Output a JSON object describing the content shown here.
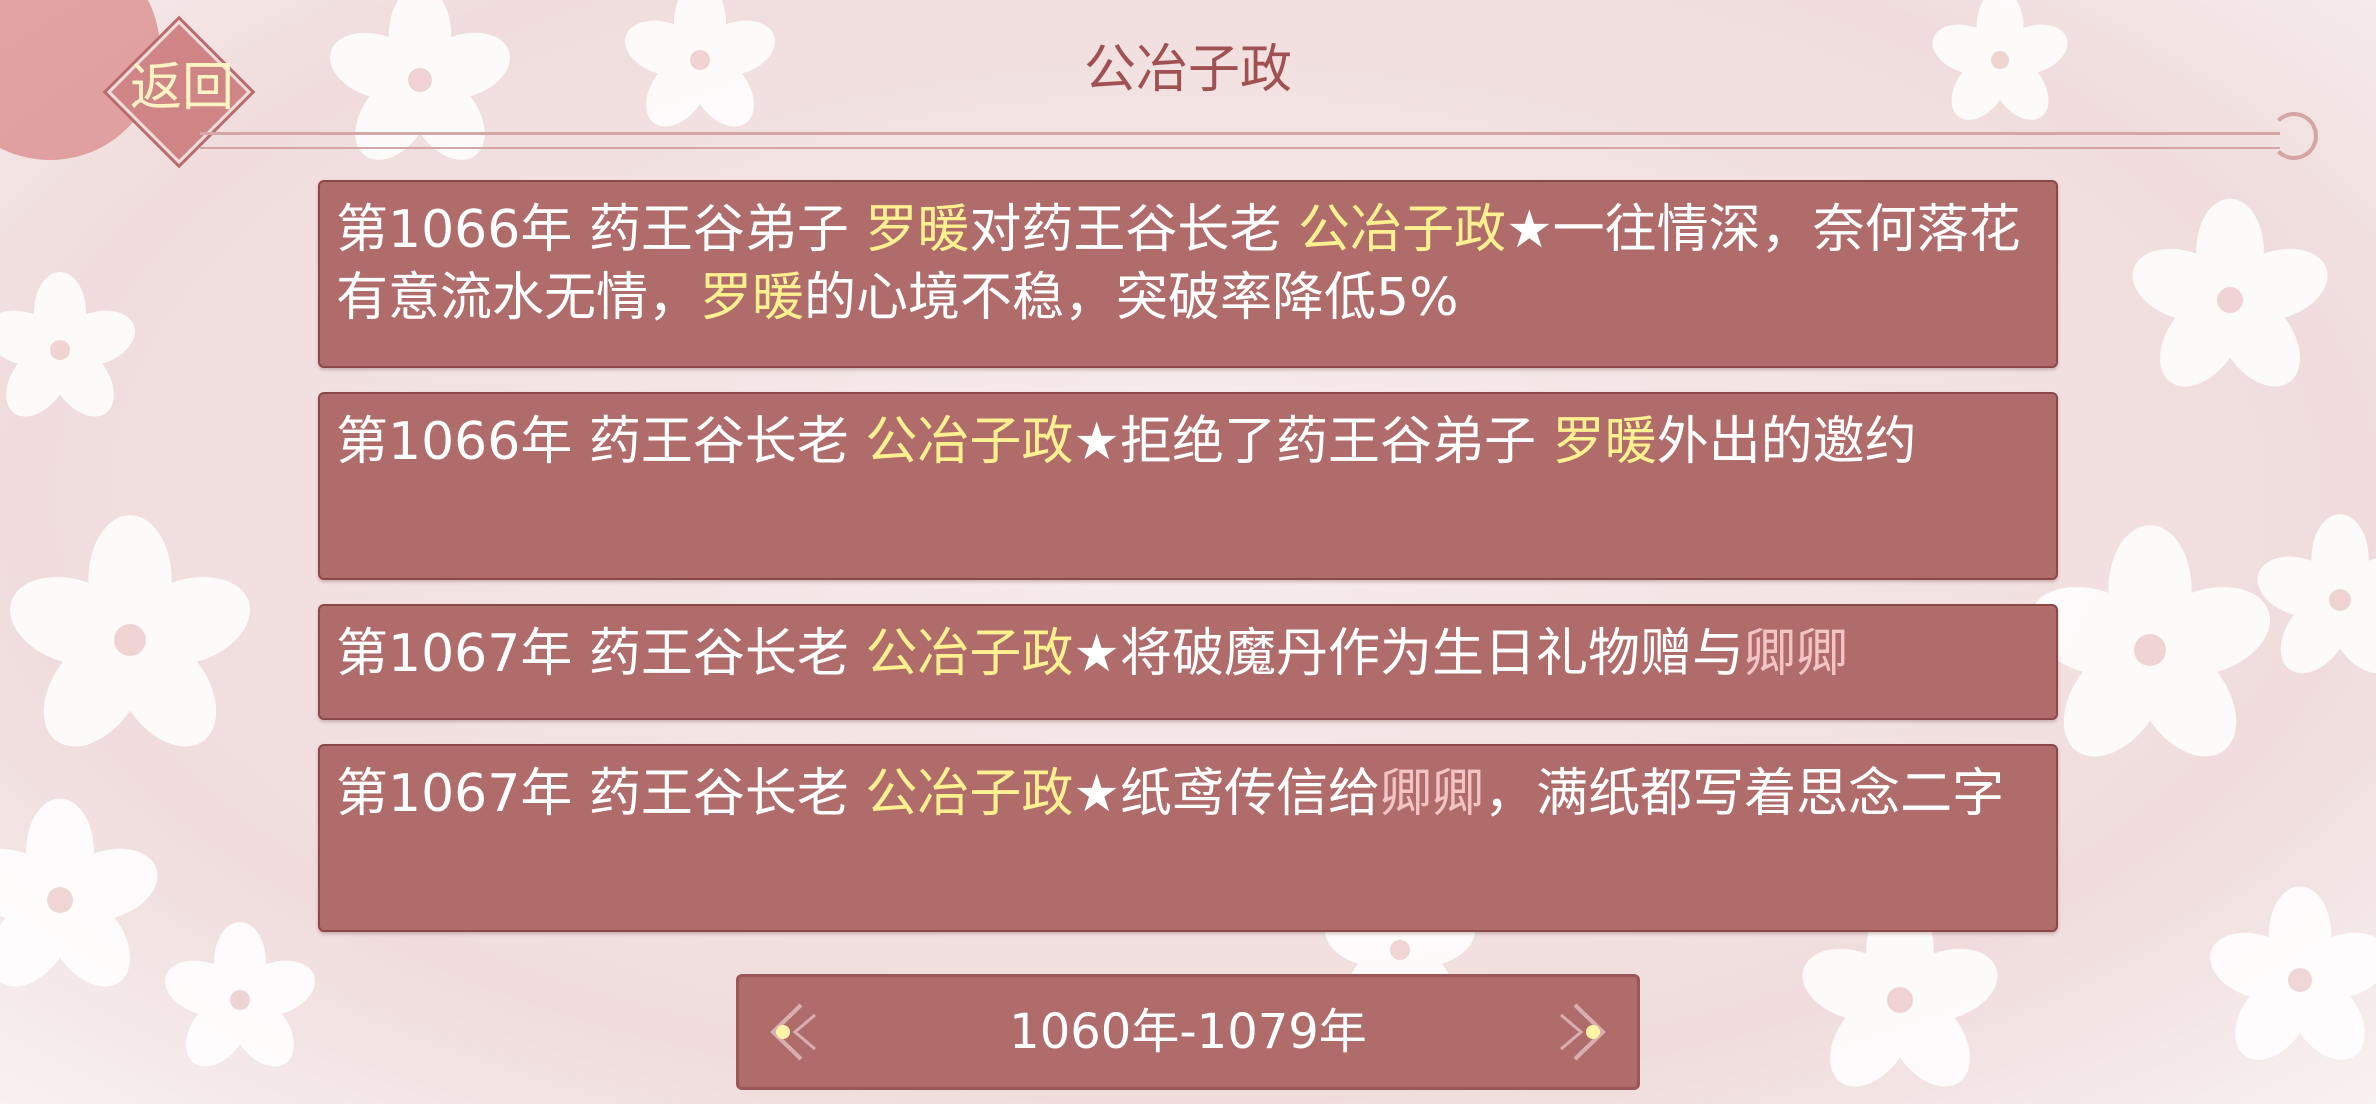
{
  "header": {
    "back_label": "返回",
    "title": "公冶子政"
  },
  "events": [
    {
      "segments": [
        {
          "text": "第1066年 药王谷弟子 ",
          "style": "normal"
        },
        {
          "text": "罗暖",
          "style": "yellow"
        },
        {
          "text": "对药王谷长老 ",
          "style": "normal"
        },
        {
          "text": "公冶子政",
          "style": "yellow"
        },
        {
          "text": "★一往情深，奈何落花有意流水无情，",
          "style": "normal"
        },
        {
          "text": "罗暖",
          "style": "yellow"
        },
        {
          "text": "的心境不稳，突破率降低5%",
          "style": "normal"
        }
      ]
    },
    {
      "segments": [
        {
          "text": "第1066年 药王谷长老 ",
          "style": "normal"
        },
        {
          "text": "公冶子政",
          "style": "yellow"
        },
        {
          "text": "★拒绝了药王谷弟子 ",
          "style": "normal"
        },
        {
          "text": "罗暖",
          "style": "yellow"
        },
        {
          "text": "外出的邀约",
          "style": "normal"
        }
      ]
    },
    {
      "segments": [
        {
          "text": "第1067年 药王谷长老 ",
          "style": "normal"
        },
        {
          "text": "公冶子政",
          "style": "yellow"
        },
        {
          "text": "★将破魔丹作为生日礼物赠与",
          "style": "normal"
        },
        {
          "text": "卿卿",
          "style": "pink"
        }
      ]
    },
    {
      "segments": [
        {
          "text": "第1067年 药王谷长老 ",
          "style": "normal"
        },
        {
          "text": "公冶子政",
          "style": "yellow"
        },
        {
          "text": "★纸鸢传信给",
          "style": "normal"
        },
        {
          "text": "卿卿",
          "style": "pink"
        },
        {
          "text": "，满纸都写着思念二字",
          "style": "normal"
        }
      ]
    }
  ],
  "era": {
    "label": "1060年-1079年"
  },
  "colors": {
    "panel": "#b06b6b",
    "highlight_yellow": "#fff190",
    "highlight_pink": "#f2c4c4",
    "title_text": "#a05252"
  }
}
